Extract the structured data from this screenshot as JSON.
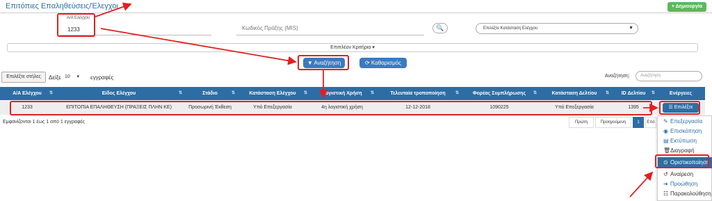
{
  "header": {
    "title": "Επιτόπιες Επαληθεύσεις/Έλεγχοι",
    "create_label": "Δημιουργία"
  },
  "filters": {
    "aa_label": "Α/Α Ελέγχου",
    "aa_value": "1233",
    "project_code_placeholder": "Κωδικός Πράξης (MIS)",
    "status_placeholder": "Επιλέξτε Κατάσταση Ελέγχου",
    "more_criteria": "Επιπλέον Κριτήρια"
  },
  "actions": {
    "search_label": "Αναζήτηση",
    "clear_label": "Καθαρισμός"
  },
  "table_controls": {
    "columns_label": "Επιλέξτε στήλες",
    "show_label": "Δείξε",
    "page_size": "10",
    "records_label": "εγγραφές",
    "search_label": "Αναζήτηση:",
    "search_placeholder": "Αναζήτηση"
  },
  "columns": [
    "Α/Α Ελέγχου",
    "Είδος Ελέγχου",
    "Στάδιο",
    "Κατάσταση Ελέγχου",
    "Λογιστική Χρήση",
    "Τελευταία τροποποίηση",
    "Φορέας Συμπλήρωσης",
    "Κατάσταση Δελτίου",
    "ID Δελτίου",
    "Ενέργειες"
  ],
  "row": {
    "aa": "1233",
    "type": "ΕΠΙΤΟΠΙΑ ΕΠΑΛΗΘΕΥΣΗ (ΠΡΑΞΕΙΣ ΠΛΗΝ ΚΕ)",
    "stage": "Προσωρινή Έκθεση",
    "status": "Υπό Επεξεργασία",
    "fiscal_year": "4η λογιστική χρήση",
    "modified": "12-12-2018",
    "body": "1090225",
    "sheet_status": "Υπό Επεξεργασία",
    "sheet_id": "1395",
    "action_label": "Επιλέξτε"
  },
  "footer": {
    "info": "Εμφανίζονται 1 έως 1 από 1 εγγραφές",
    "first": "Πρώτη",
    "prev": "Προηγούμενη",
    "page": "1",
    "next": "Επό"
  },
  "menu": [
    "Επεξεργασία",
    "Επισκόπηση",
    "Εκτύπωση",
    "Διαγραφή",
    "Οριστικοποίηση",
    "Αναίρεση",
    "Προώθηση",
    "Παρακολούθηση"
  ],
  "colors": {
    "primary": "#2e6da4",
    "success": "#5cb85c",
    "highlight": "#e02020"
  }
}
